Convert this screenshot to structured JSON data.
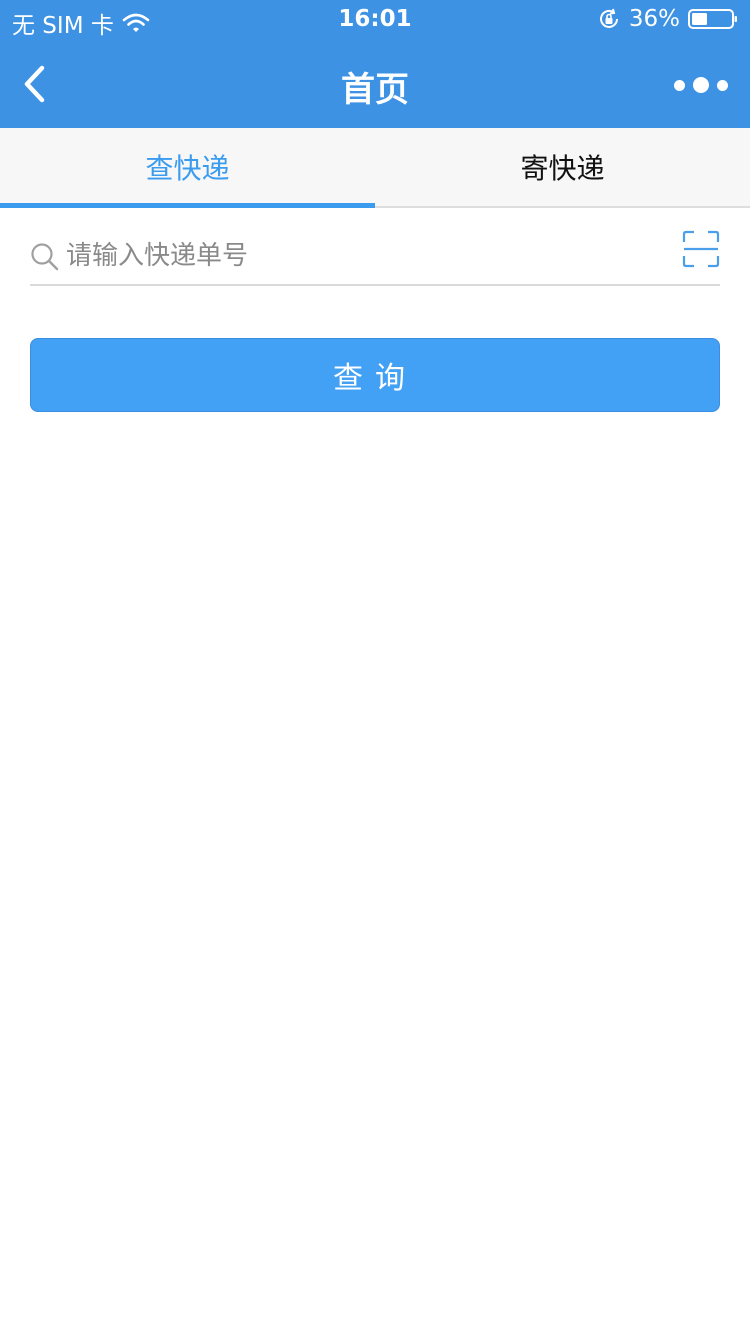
{
  "status_bar": {
    "carrier": "无 SIM 卡",
    "time": "16:01",
    "battery": "36%",
    "icons": [
      "wifi-icon",
      "rotation-lock-icon",
      "battery-icon"
    ]
  },
  "nav": {
    "title": "首页",
    "back_icon": "chevron-left-icon",
    "more_icon": "more-dots-icon"
  },
  "tabs": [
    {
      "label": "查快递",
      "active": true
    },
    {
      "label": "寄快递",
      "active": false
    }
  ],
  "search": {
    "placeholder": "请输入快递单号",
    "value": "",
    "icon": "search-icon",
    "scan_icon": "scan-icon"
  },
  "query_button": {
    "label": "查询"
  },
  "colors": {
    "header_bg": "#3d92e4",
    "accent": "#3b9cef",
    "button_bg": "#42a1f5",
    "tab_bg": "#f7f7f7"
  }
}
